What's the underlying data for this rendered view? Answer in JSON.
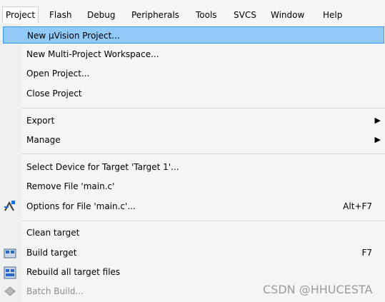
{
  "menubar": [
    "Project",
    "Flash",
    "Debug",
    "Peripherals",
    "Tools",
    "SVCS",
    "Window",
    "Help"
  ],
  "menu": {
    "new_uvision_project": "New µVision Project...",
    "new_multi_project": "New Multi-Project Workspace...",
    "open_project": "Open Project...",
    "close_project": "Close Project",
    "export": "Export",
    "manage": "Manage",
    "select_device": "Select Device for Target 'Target 1'...",
    "remove_file": "Remove File 'main.c'",
    "options_for_file": "Options for File 'main.c'...",
    "options_shortcut": "Alt+F7",
    "clean_target": "Clean target",
    "build_target": "Build target",
    "build_shortcut": "F7",
    "rebuild_all": "Rebuild all target files",
    "batch_build": "Batch Build..."
  },
  "watermark": "CSDN @HHUCESTA",
  "colors": {
    "highlight_bg": "#91c9f7",
    "highlight_border": "#3399ff",
    "disabled_text": "#8c8c8c"
  }
}
